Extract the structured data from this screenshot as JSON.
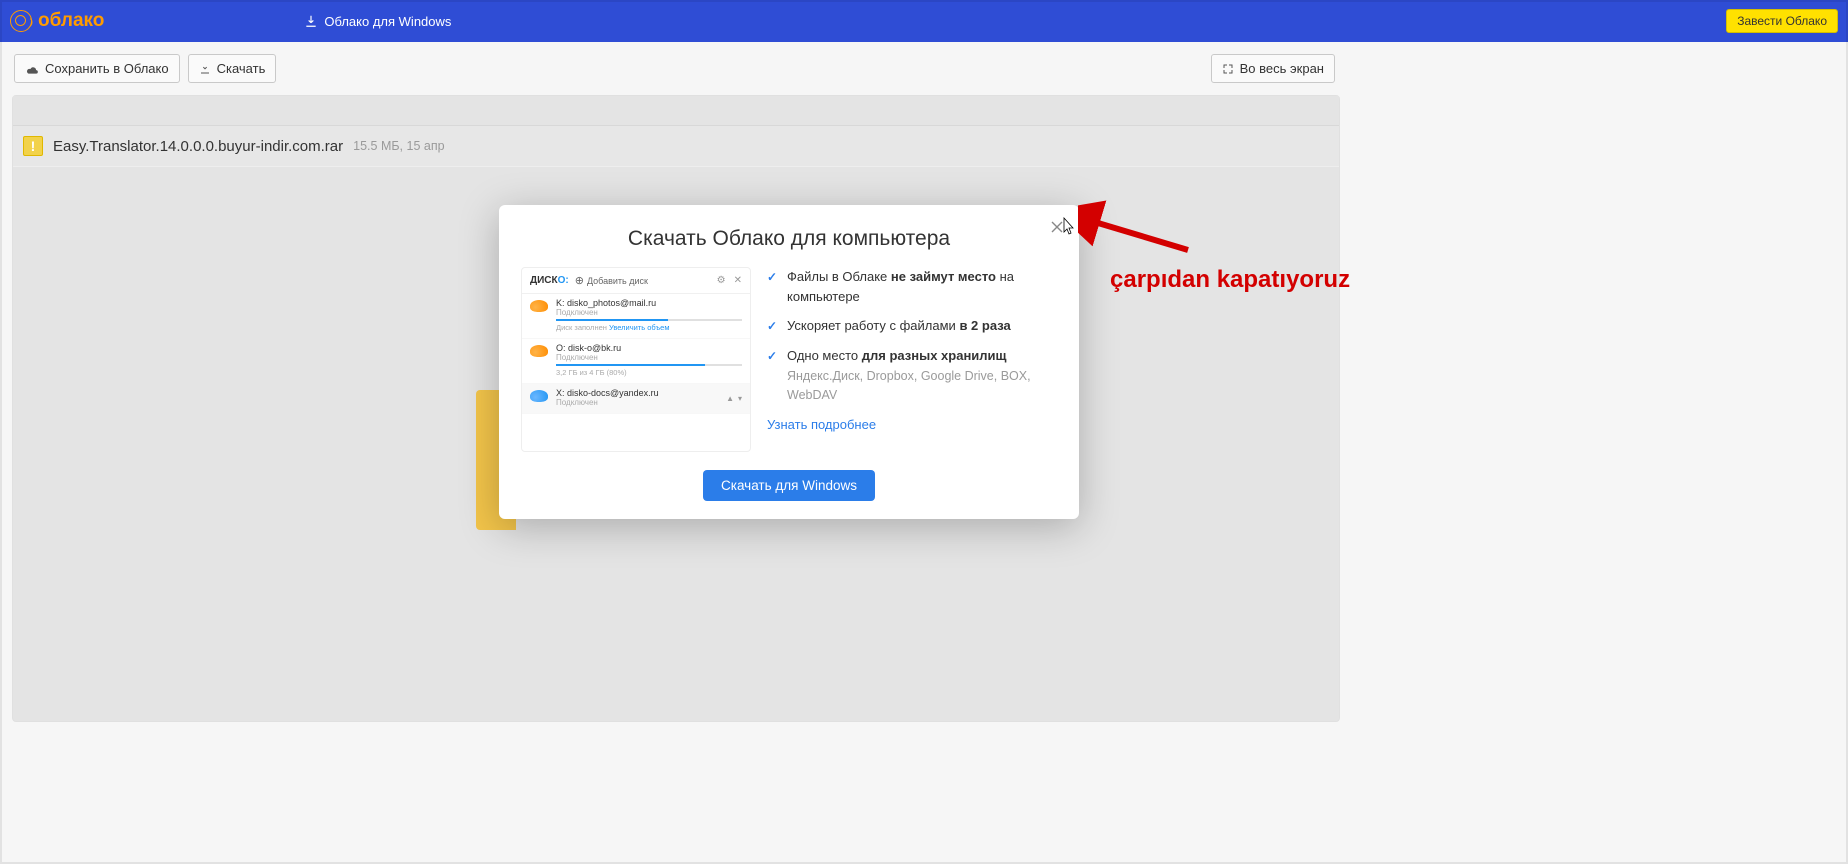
{
  "header": {
    "logo_text": "облако",
    "windows_link": "Облако для Windows",
    "signup_label": "Завести Облако"
  },
  "toolbar": {
    "save_label": "Сохранить в Облако",
    "download_label": "Скачать",
    "fullscreen_label": "Во весь экран"
  },
  "file": {
    "name": "Easy.Translator.14.0.0.0.buyur-indir.com.rar",
    "meta": "15.5 МБ, 15 апр"
  },
  "modal": {
    "title": "Скачать Облако для компьютера",
    "features": [
      {
        "text_pre": "Файлы в Облаке ",
        "text_bold": "не займут место",
        "text_post": " на компьютере"
      },
      {
        "text_pre": "Ускоряет работу с файлами ",
        "text_bold": "в 2 раза",
        "text_post": ""
      },
      {
        "text_pre": "Одно место ",
        "text_bold": "для разных хранилищ",
        "text_post": ""
      }
    ],
    "feature_sub": "Яндекс.Диск, Dropbox, Google Drive, BOX, WebDAV",
    "learn_more": "Узнать подробнее",
    "cta_label": "Скачать для Windows"
  },
  "disko": {
    "logo_part1": "ДИСК",
    "logo_part2": "О:",
    "add_label": "Добавить диск",
    "items": [
      {
        "drive": "K: disko_photos@mail.ru",
        "status": "Подключен",
        "sub": "Диск заполнен  ",
        "sub_link": "Увеличить объем"
      },
      {
        "drive": "O: disk-o@bk.ru",
        "status": "Подключен",
        "sub": "3,2 ГБ из 4 ГБ (80%)",
        "sub_link": ""
      },
      {
        "drive": "X: disko-docs@yandex.ru",
        "status": "Подключен",
        "sub": "",
        "sub_link": ""
      }
    ]
  },
  "annotation": "çarpıdan kapatıyoruz"
}
